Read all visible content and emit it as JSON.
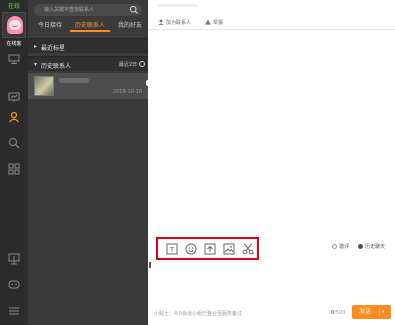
{
  "sidebar": {
    "status": "在线",
    "nickname": "在线客",
    "icons": [
      "monitor-icon",
      "contacts-icon",
      "search-person-icon",
      "apps-icon",
      "screen-share-icon",
      "chat-bubble-icon",
      "menu-icon"
    ]
  },
  "search": {
    "placeholder": "输入关键字查找联系人"
  },
  "tabs": [
    {
      "label": "今日接待",
      "active": false
    },
    {
      "label": "历史联系人",
      "active": true
    },
    {
      "label": "我的好友",
      "active": false
    }
  ],
  "sections": {
    "recent": {
      "label": "最近标星"
    },
    "history": {
      "label": "历史联系人",
      "filter": "最近2日"
    }
  },
  "contacts": [
    {
      "date": "2018-10-18"
    }
  ],
  "chat": {
    "header_add": "加为联系人",
    "header_report": "举报",
    "radio_evaluate": "邀评",
    "radio_history": "历史聊天",
    "tip": "小贴士：4.0会话小组已整合至服务备注",
    "counter_value": "0",
    "counter_max": "/500",
    "send_label": "发送"
  },
  "colors": {
    "accent": "#ff8c1a",
    "highlight_frame": "#e0001b",
    "status_green": "#7ccf4a",
    "rail_bg": "#2b2b2b",
    "panel_bg": "#3a3a3a"
  }
}
